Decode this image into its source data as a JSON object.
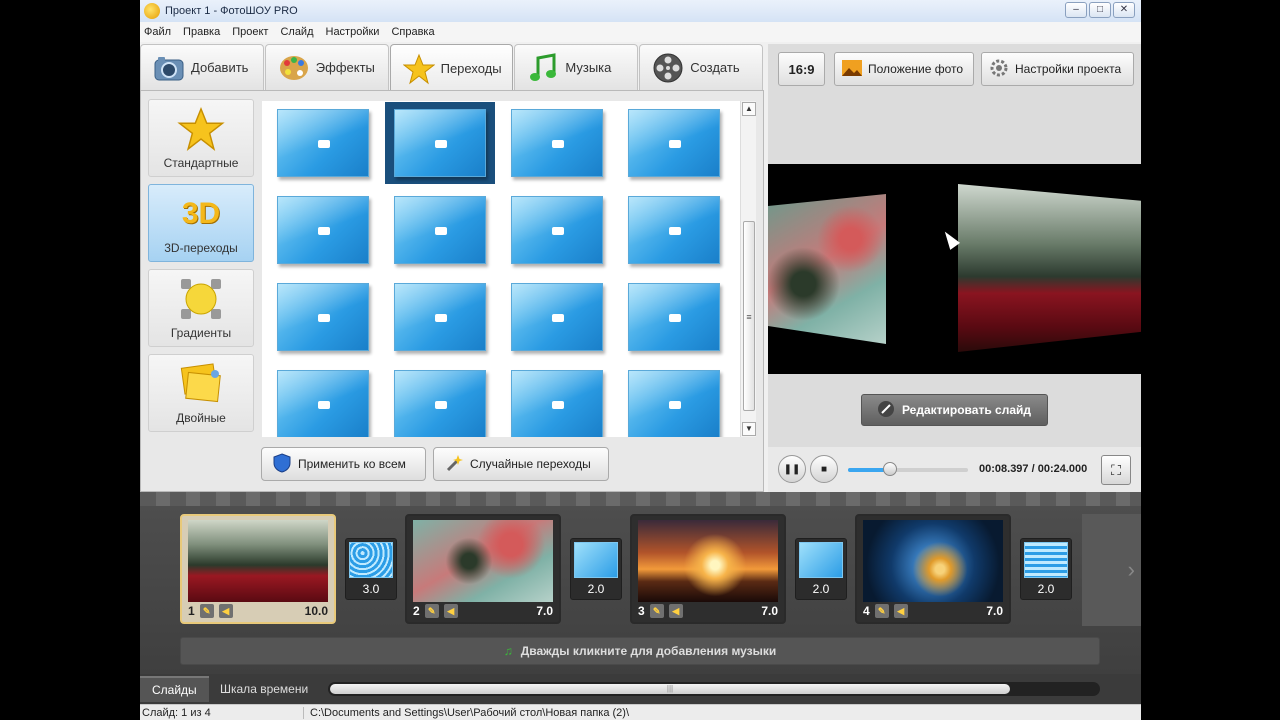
{
  "window": {
    "title": "Проект 1 - ФотоШОУ PRO"
  },
  "menu": [
    "Файл",
    "Правка",
    "Проект",
    "Слайд",
    "Настройки",
    "Справка"
  ],
  "tabs": [
    {
      "label": "Добавить",
      "icon": "camera-icon"
    },
    {
      "label": "Эффекты",
      "icon": "palette-icon"
    },
    {
      "label": "Переходы",
      "icon": "star-icon",
      "active": true
    },
    {
      "label": "Музыка",
      "icon": "music-note-icon"
    },
    {
      "label": "Создать",
      "icon": "film-reel-icon"
    }
  ],
  "categories": [
    {
      "label": "Стандартные",
      "icon": "star-icon"
    },
    {
      "label": "3D-переходы",
      "icon": "3d-icon",
      "active": true,
      "icon_text": "3D"
    },
    {
      "label": "Градиенты",
      "icon": "gradient-circle-icon"
    },
    {
      "label": "Двойные",
      "icon": "double-pin-icon"
    }
  ],
  "transitions_grid": {
    "rows": 4,
    "cols": 4,
    "selected_index": 1
  },
  "actions": {
    "apply_all": "Применить ко всем",
    "random": "Случайные переходы"
  },
  "right_toolbar": {
    "ratio": "16:9",
    "photo_position": "Положение фото",
    "project_settings": "Настройки проекта"
  },
  "preview": {
    "edit_slide": "Редактировать слайд"
  },
  "player": {
    "time": "00:08.397 / 00:24.000",
    "progress": 0.35
  },
  "slides": [
    {
      "num": "1",
      "duration": "10.0",
      "selected": true
    },
    {
      "num": "2",
      "duration": "7.0"
    },
    {
      "num": "3",
      "duration": "7.0"
    },
    {
      "num": "4",
      "duration": "7.0"
    }
  ],
  "transitions": [
    {
      "duration": "3.0"
    },
    {
      "duration": "2.0"
    },
    {
      "duration": "2.0"
    },
    {
      "duration": "2.0"
    }
  ],
  "music_hint": "Дважды кликните для добавления музыки",
  "bottom_tabs": {
    "slides": "Слайды",
    "timeline": "Шкала времени"
  },
  "status": {
    "slide_info": "Слайд: 1 из 4",
    "path": "C:\\Documents and Settings\\User\\Рабочий стол\\Новая папка (2)\\"
  },
  "colors": {
    "accent": "#3aa6f0",
    "film_bg": "#4a4a4a",
    "selected_slide": "#e8c97a"
  }
}
